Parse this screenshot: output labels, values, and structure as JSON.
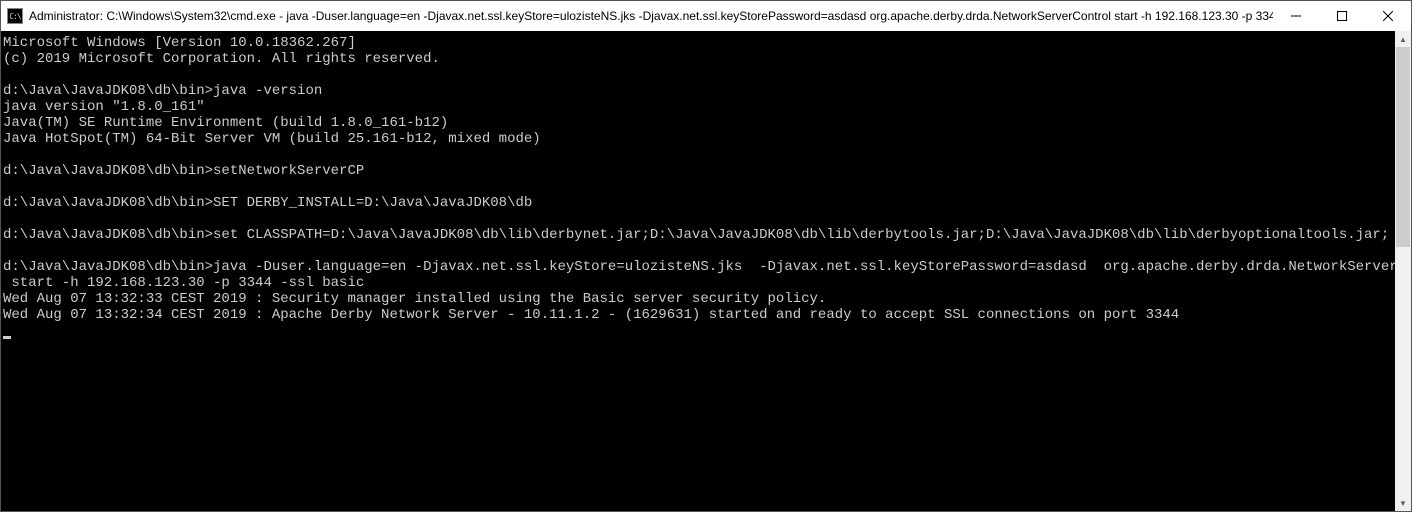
{
  "titlebar": {
    "icon_label": "C:\\",
    "title": "Administrator: C:\\Windows\\System32\\cmd.exe - java  -Duser.language=en -Djavax.net.ssl.keyStore=ulozisteNS.jks  -Djavax.net.ssl.keyStorePassword=asdasd  org.apache.derby.drda.NetworkServerControl start -h 192.168.123.30 -p 334..."
  },
  "terminal": {
    "lines": [
      "Microsoft Windows [Version 10.0.18362.267]",
      "(c) 2019 Microsoft Corporation. All rights reserved.",
      "",
      "d:\\Java\\JavaJDK08\\db\\bin>java -version",
      "java version \"1.8.0_161\"",
      "Java(TM) SE Runtime Environment (build 1.8.0_161-b12)",
      "Java HotSpot(TM) 64-Bit Server VM (build 25.161-b12, mixed mode)",
      "",
      "d:\\Java\\JavaJDK08\\db\\bin>setNetworkServerCP",
      "",
      "d:\\Java\\JavaJDK08\\db\\bin>SET DERBY_INSTALL=D:\\Java\\JavaJDK08\\db",
      "",
      "d:\\Java\\JavaJDK08\\db\\bin>set CLASSPATH=D:\\Java\\JavaJDK08\\db\\lib\\derbynet.jar;D:\\Java\\JavaJDK08\\db\\lib\\derbytools.jar;D:\\Java\\JavaJDK08\\db\\lib\\derbyoptionaltools.jar;",
      "",
      "d:\\Java\\JavaJDK08\\db\\bin>java -Duser.language=en -Djavax.net.ssl.keyStore=ulozisteNS.jks  -Djavax.net.ssl.keyStorePassword=asdasd  org.apache.derby.drda.NetworkServerControl",
      " start -h 192.168.123.30 -p 3344 -ssl basic",
      "Wed Aug 07 13:32:33 CEST 2019 : Security manager installed using the Basic server security policy.",
      "Wed Aug 07 13:32:34 CEST 2019 : Apache Derby Network Server - 10.11.1.2 - (1629631) started and ready to accept SSL connections on port 3344"
    ]
  }
}
